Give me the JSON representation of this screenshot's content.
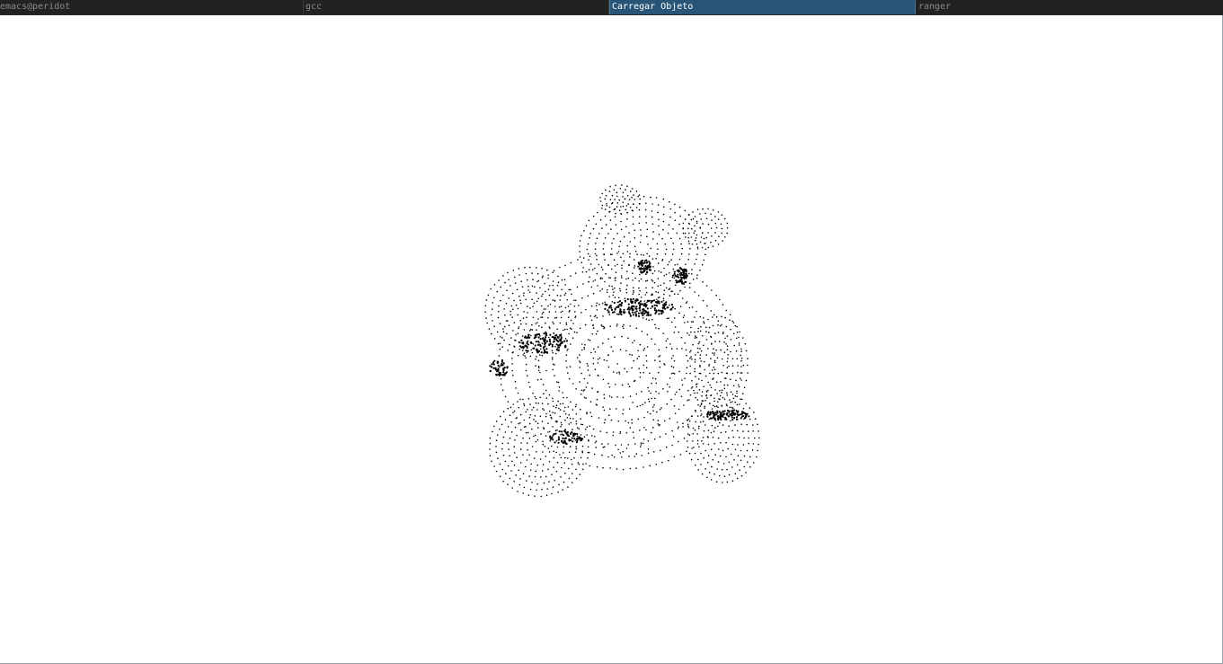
{
  "tabs": [
    {
      "label": "emacs@peridot",
      "active": false
    },
    {
      "label": "gcc",
      "active": false
    },
    {
      "label": "Carregar Objeto",
      "active": true
    },
    {
      "label": "ranger",
      "active": false
    }
  ],
  "viewport": {
    "content": "teddy-bear point cloud",
    "point_color": "#000000",
    "background_color": "#ffffff"
  },
  "colors": {
    "tabbar_bg": "#222222",
    "active_tab_bg": "#285577",
    "inactive_text": "#8a8a8a",
    "active_text": "#ffffff"
  }
}
